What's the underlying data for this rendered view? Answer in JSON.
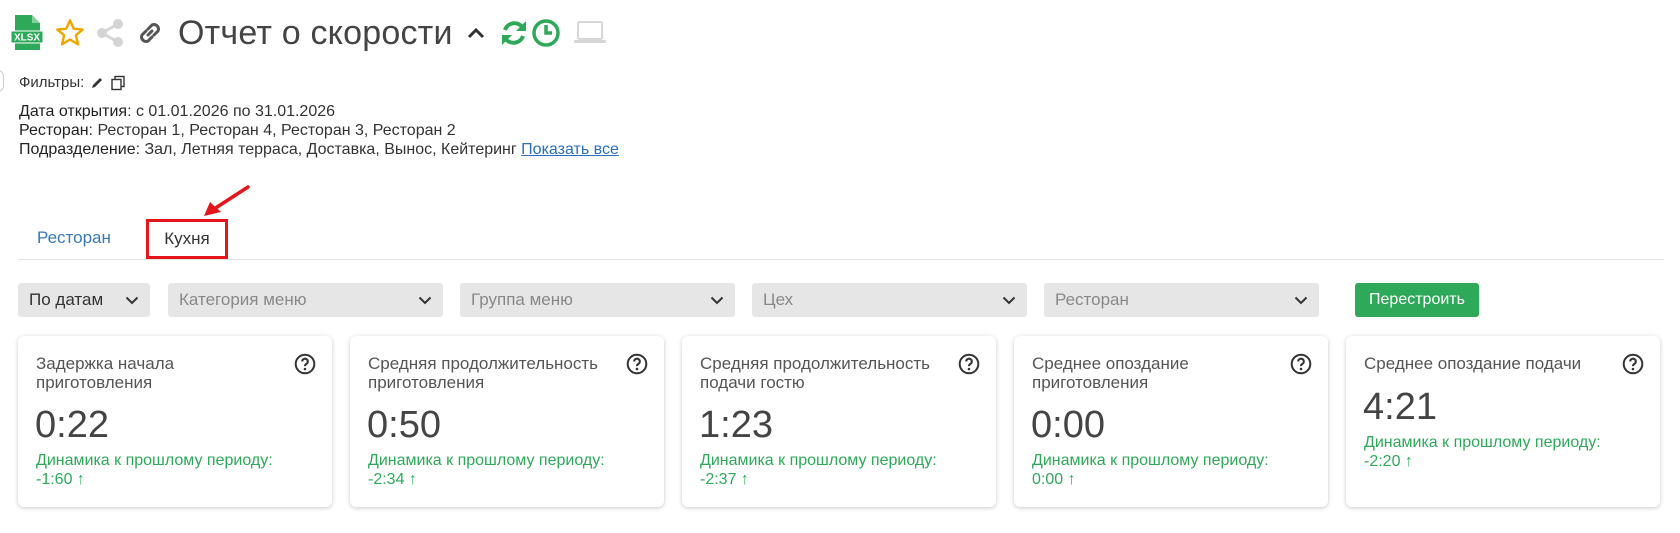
{
  "report": {
    "title": "Отчет о скорости",
    "xlsx_label": "XLSX"
  },
  "filters": {
    "label": "Фильтры:",
    "rows": [
      {
        "label": "Дата открытия",
        "value": ": с 01.01.2026 по 31.01.2026"
      },
      {
        "label": "Ресторан",
        "value": ": Ресторан 1, Ресторан 4, Ресторан 3, Ресторан 2"
      },
      {
        "label": "Подразделение",
        "value": ": Зал, Летняя терраса, Доставка, Вынос, Кейтеринг "
      }
    ],
    "show_all": "Показать все"
  },
  "tabs": [
    {
      "label": "Ресторан"
    },
    {
      "label": "Кухня"
    }
  ],
  "selects": [
    {
      "value": "По датам"
    },
    {
      "value": "Категория меню"
    },
    {
      "value": "Группа меню"
    },
    {
      "value": "Цех"
    },
    {
      "value": "Ресторан"
    }
  ],
  "rebuild_button": "Перестроить",
  "cards": [
    {
      "title": "Задержка начала приготовления",
      "value": "0:22",
      "dynamics_label": "Динамика к прошлому периоду:",
      "dynamics_value": "-1:60 ↑"
    },
    {
      "title": "Средняя продолжительность приготовления",
      "value": "0:50",
      "dynamics_label": "Динамика к прошлому периоду:",
      "dynamics_value": "-2:34 ↑"
    },
    {
      "title": "Средняя продолжительность подачи гостю",
      "value": "1:23",
      "dynamics_label": "Динамика к прошлому периоду:",
      "dynamics_value": "-2:37 ↑"
    },
    {
      "title": "Среднее опоздание приготовления",
      "value": "0:00",
      "dynamics_label": "Динамика к прошлому периоду:",
      "dynamics_value": "0:00 ↑"
    },
    {
      "title": "Среднее опоздание подачи",
      "value": "4:21",
      "dynamics_label": "Динамика к прошлому периоду:",
      "dynamics_value": "-2:20 ↑"
    }
  ],
  "colors": {
    "accent_green": "#2ea95a",
    "tab_link": "#3a78b8",
    "annotation_red": "#e4161b"
  }
}
